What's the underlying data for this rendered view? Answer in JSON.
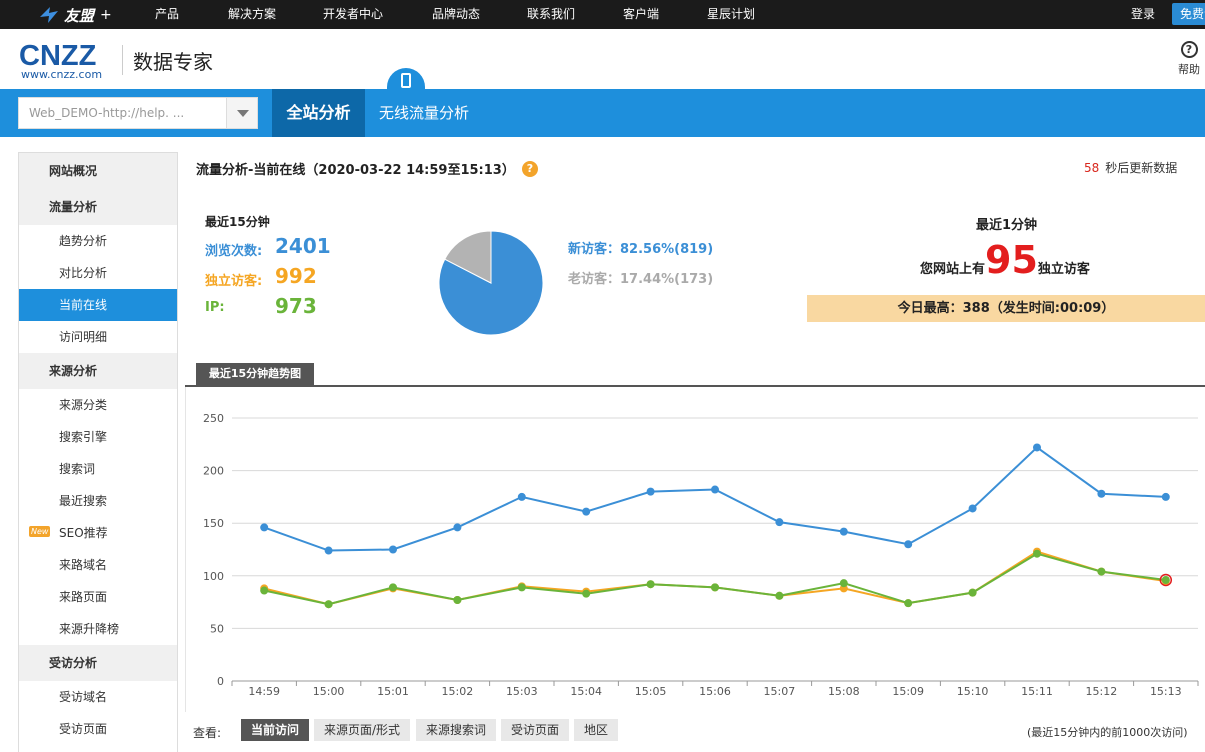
{
  "topbar": {
    "brand": "友盟",
    "brand_plus": "+",
    "nav": [
      "产品",
      "解决方案",
      "开发者中心",
      "品牌动态",
      "联系我们",
      "客户端",
      "星辰计划"
    ],
    "login": "登录",
    "free_register": "免费注册"
  },
  "header": {
    "logo_big": "CNZZ",
    "logo_small": "www.cnzz.com",
    "product_name": "数据专家",
    "help_label": "帮助",
    "help_icon_glyph": "?"
  },
  "band": {
    "site_select_value": "Web_DEMO-http://help. ...",
    "tab_main": "全站分析",
    "tab_wireless": "无线流量分析"
  },
  "sidebar": {
    "items": [
      {
        "label": "网站概况",
        "kind": "group"
      },
      {
        "label": "流量分析",
        "kind": "group"
      },
      {
        "label": "趋势分析",
        "kind": "sub"
      },
      {
        "label": "对比分析",
        "kind": "sub"
      },
      {
        "label": "当前在线",
        "kind": "sub",
        "active": true
      },
      {
        "label": "访问明细",
        "kind": "sub"
      },
      {
        "label": "来源分析",
        "kind": "group"
      },
      {
        "label": "来源分类",
        "kind": "sub"
      },
      {
        "label": "搜索引擎",
        "kind": "sub"
      },
      {
        "label": "搜索词",
        "kind": "sub"
      },
      {
        "label": "最近搜索",
        "kind": "sub"
      },
      {
        "label": "SEO推荐",
        "kind": "sub",
        "badge": "New"
      },
      {
        "label": "来路域名",
        "kind": "sub"
      },
      {
        "label": "来路页面",
        "kind": "sub"
      },
      {
        "label": "来源升降榜",
        "kind": "sub"
      },
      {
        "label": "受访分析",
        "kind": "group"
      },
      {
        "label": "受访域名",
        "kind": "sub"
      },
      {
        "label": "受访页面",
        "kind": "sub"
      }
    ]
  },
  "main": {
    "title": "流量分析-当前在线（2020-03-22 14:59至15:13）",
    "help_glyph": "?",
    "refresh_seconds": "58",
    "refresh_text": "秒后更新数据",
    "last15_label": "最近15分钟",
    "pv_label": "浏览次数:",
    "pv_value": "2401",
    "uv_label": "独立访客:",
    "uv_value": "992",
    "ip_label": "IP:",
    "ip_value": "973",
    "new_visitors": "新访客：82.56%(819)",
    "old_visitors": "老访客：17.44%(173)",
    "new_fraction": 0.8256,
    "last1_title": "最近1分钟",
    "last1_prefix": "您网站上有",
    "last1_value": "95",
    "last1_suffix": "独立访客",
    "peak_text": "今日最高：388（发生时间:00:09）",
    "trend_tab": "最近15分钟趋势图",
    "view_label": "查看:",
    "view_tabs": [
      "当前访问",
      "来源页面/形式",
      "来源搜索词",
      "受访页面",
      "地区"
    ],
    "note": "(最近15分钟内的前1000次访问)"
  },
  "colors": {
    "blue": "#3b8fd6",
    "orange": "#f5a623",
    "green": "#6ab43a",
    "gray": "#b3b3b3",
    "accent": "#1e8fdc"
  },
  "chart_data": {
    "type": "line",
    "categories": [
      "14:59",
      "15:00",
      "15:01",
      "15:02",
      "15:03",
      "15:04",
      "15:05",
      "15:06",
      "15:07",
      "15:08",
      "15:09",
      "15:10",
      "15:11",
      "15:12",
      "15:13"
    ],
    "ylim": [
      0,
      250
    ],
    "yticks": [
      0,
      50,
      100,
      150,
      200,
      250
    ],
    "grid": true,
    "series": [
      {
        "key": "pv",
        "color": "#3b8fd6",
        "values": [
          146,
          124,
          125,
          146,
          175,
          161,
          180,
          182,
          151,
          142,
          130,
          164,
          222,
          178,
          175
        ]
      },
      {
        "key": "uv",
        "color": "#f5a623",
        "values": [
          88,
          73,
          88,
          77,
          90,
          85,
          92,
          89,
          81,
          88,
          74,
          84,
          123,
          104,
          95
        ]
      },
      {
        "key": "ip",
        "color": "#6ab43a",
        "values": [
          86,
          73,
          89,
          77,
          89,
          83,
          92,
          89,
          81,
          93,
          74,
          84,
          121,
          104,
          96
        ]
      }
    ]
  }
}
